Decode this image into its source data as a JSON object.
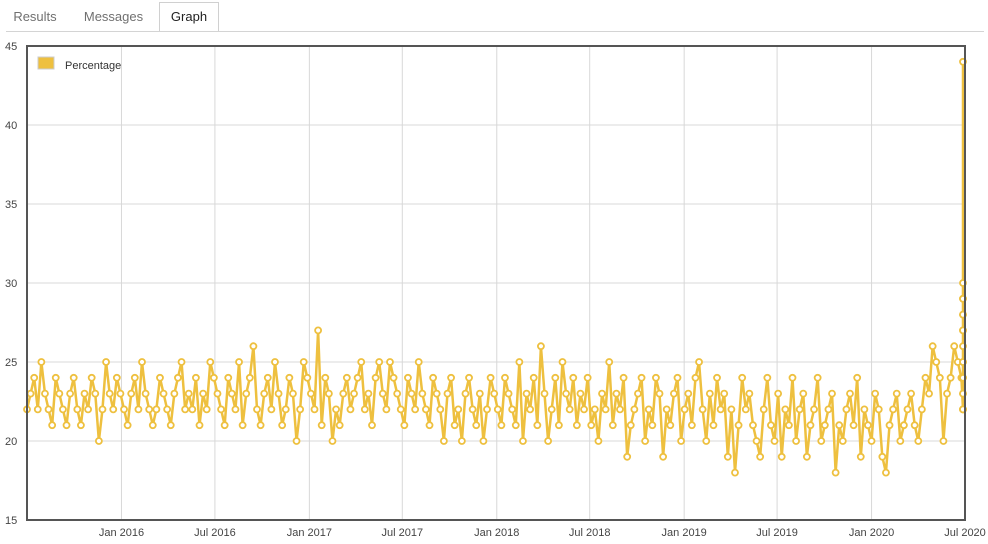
{
  "tabs": [
    {
      "label": "Results",
      "active": false
    },
    {
      "label": "Messages",
      "active": false
    },
    {
      "label": "Graph",
      "active": true
    }
  ],
  "colors": {
    "series": "#eec03f",
    "point_fill": "#ffffff",
    "grid": "#d8d8d8",
    "axis": "#555555"
  },
  "chart_data": {
    "type": "line",
    "title": "",
    "xlabel": "",
    "ylabel": "",
    "legend": {
      "entries": [
        "Percentage"
      ],
      "placement": "top-left"
    },
    "grid": true,
    "ylim": [
      15,
      45
    ],
    "yticks": [
      15,
      20,
      25,
      30,
      35,
      40,
      45
    ],
    "xlim": [
      "2015-07-01",
      "2020-07-01"
    ],
    "xticks": [
      {
        "date": "2016-01-01",
        "label": "Jan 2016"
      },
      {
        "date": "2016-07-01",
        "label": "Jul 2016"
      },
      {
        "date": "2017-01-01",
        "label": "Jan 2017"
      },
      {
        "date": "2017-07-01",
        "label": "Jul 2017"
      },
      {
        "date": "2018-01-01",
        "label": "Jan 2018"
      },
      {
        "date": "2018-07-01",
        "label": "Jul 2018"
      },
      {
        "date": "2019-01-01",
        "label": "Jan 2019"
      },
      {
        "date": "2019-07-01",
        "label": "Jul 2019"
      },
      {
        "date": "2020-01-01",
        "label": "Jan 2020"
      },
      {
        "date": "2020-07-01",
        "label": "Jul 2020"
      }
    ],
    "series": [
      {
        "name": "Percentage",
        "start_date": "2015-07-01",
        "step_days": 7,
        "values": [
          22,
          23,
          24,
          22,
          25,
          23,
          22,
          21,
          24,
          23,
          22,
          21,
          23,
          24,
          22,
          21,
          23,
          22,
          24,
          23,
          20,
          22,
          25,
          23,
          22,
          24,
          23,
          22,
          21,
          23,
          24,
          22,
          25,
          23,
          22,
          21,
          22,
          24,
          23,
          22,
          21,
          23,
          24,
          25,
          22,
          23,
          22,
          24,
          21,
          23,
          22,
          25,
          24,
          23,
          22,
          21,
          24,
          23,
          22,
          25,
          21,
          23,
          24,
          26,
          22,
          21,
          23,
          24,
          22,
          25,
          23,
          21,
          22,
          24,
          23,
          20,
          22,
          25,
          24,
          23,
          22,
          27,
          21,
          24,
          23,
          20,
          22,
          21,
          23,
          24,
          22,
          23,
          24,
          25,
          22,
          23,
          21,
          24,
          25,
          23,
          22,
          25,
          24,
          23,
          22,
          21,
          24,
          23,
          22,
          25,
          23,
          22,
          21,
          24,
          23,
          22,
          20,
          23,
          24,
          21,
          22,
          20,
          23,
          24,
          22,
          21,
          23,
          20,
          22,
          24,
          23,
          22,
          21,
          24,
          23,
          22,
          21,
          25,
          20,
          23,
          22,
          24,
          21,
          26,
          23,
          20,
          22,
          24,
          21,
          25,
          23,
          22,
          24,
          21,
          23,
          22,
          24,
          21,
          22,
          20,
          23,
          22,
          25,
          21,
          23,
          22,
          24,
          19,
          21,
          22,
          23,
          24,
          20,
          22,
          21,
          24,
          23,
          19,
          22,
          21,
          23,
          24,
          20,
          22,
          23,
          21,
          24,
          25,
          22,
          20,
          23,
          21,
          24,
          22,
          23,
          19,
          22,
          18,
          21,
          24,
          22,
          23,
          21,
          20,
          19,
          22,
          24,
          21,
          20,
          23,
          19,
          22,
          21,
          24,
          20,
          22,
          23,
          19,
          21,
          22,
          24,
          20,
          21,
          22,
          23,
          18,
          21,
          20,
          22,
          23,
          21,
          24,
          19,
          22,
          21,
          20,
          23,
          22,
          19,
          18,
          21,
          22,
          23,
          20,
          21,
          22,
          23,
          21,
          20,
          22,
          24,
          23,
          26,
          25,
          24,
          20,
          23,
          24,
          26,
          25,
          24,
          22,
          23,
          24,
          22,
          25,
          23,
          24,
          22,
          29,
          27,
          28,
          30,
          26,
          29,
          25,
          27,
          28,
          44
        ]
      }
    ]
  }
}
